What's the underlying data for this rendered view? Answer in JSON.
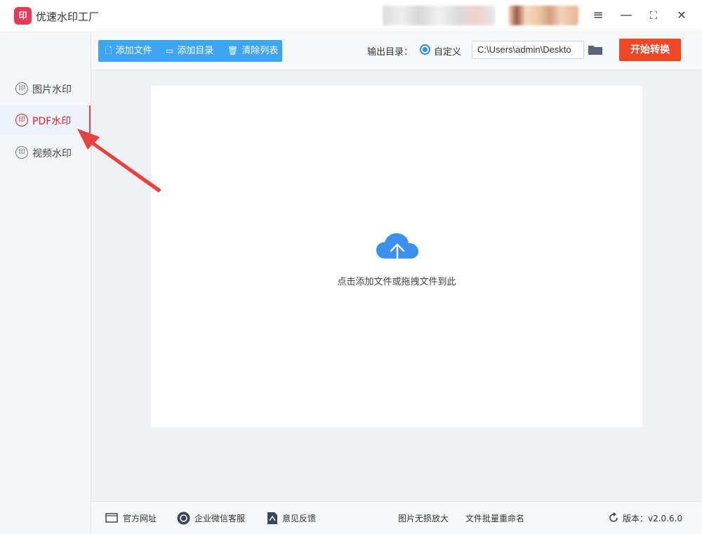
{
  "app": {
    "title": "优速水印工厂",
    "logo_text": "印"
  },
  "window_controls": {
    "menu": "≡",
    "minimize": "—",
    "maximize": "⛶",
    "close": "✕"
  },
  "sidebar": {
    "items": [
      {
        "label": "图片水印",
        "icon": "印"
      },
      {
        "label": "PDF水印",
        "icon": "印",
        "active": true
      },
      {
        "label": "视频水印",
        "icon": "印"
      }
    ]
  },
  "toolbar": {
    "add_file": "添加文件",
    "add_folder": "添加目录",
    "clear_list": "清除列表",
    "output_label": "输出目录：",
    "radio_custom": "自定义",
    "output_path": "C:\\Users\\admin\\Deskto",
    "start": "开始转换"
  },
  "dropzone": {
    "text": "点击添加文件或拖拽文件到此",
    "icon": "cloud-upload-icon"
  },
  "footer": {
    "website": "官方网址",
    "wechat": "企业微信客服",
    "feedback": "意见反馈",
    "image_enlarge": "图片无损放大",
    "batch_rename": "文件批量重命名",
    "version": "版本：v2.0.6.0"
  },
  "colors": {
    "accent": "#3ca6f5",
    "start_button": "#f04726",
    "active_red": "#d9232f",
    "arrow": "#e8413e"
  }
}
